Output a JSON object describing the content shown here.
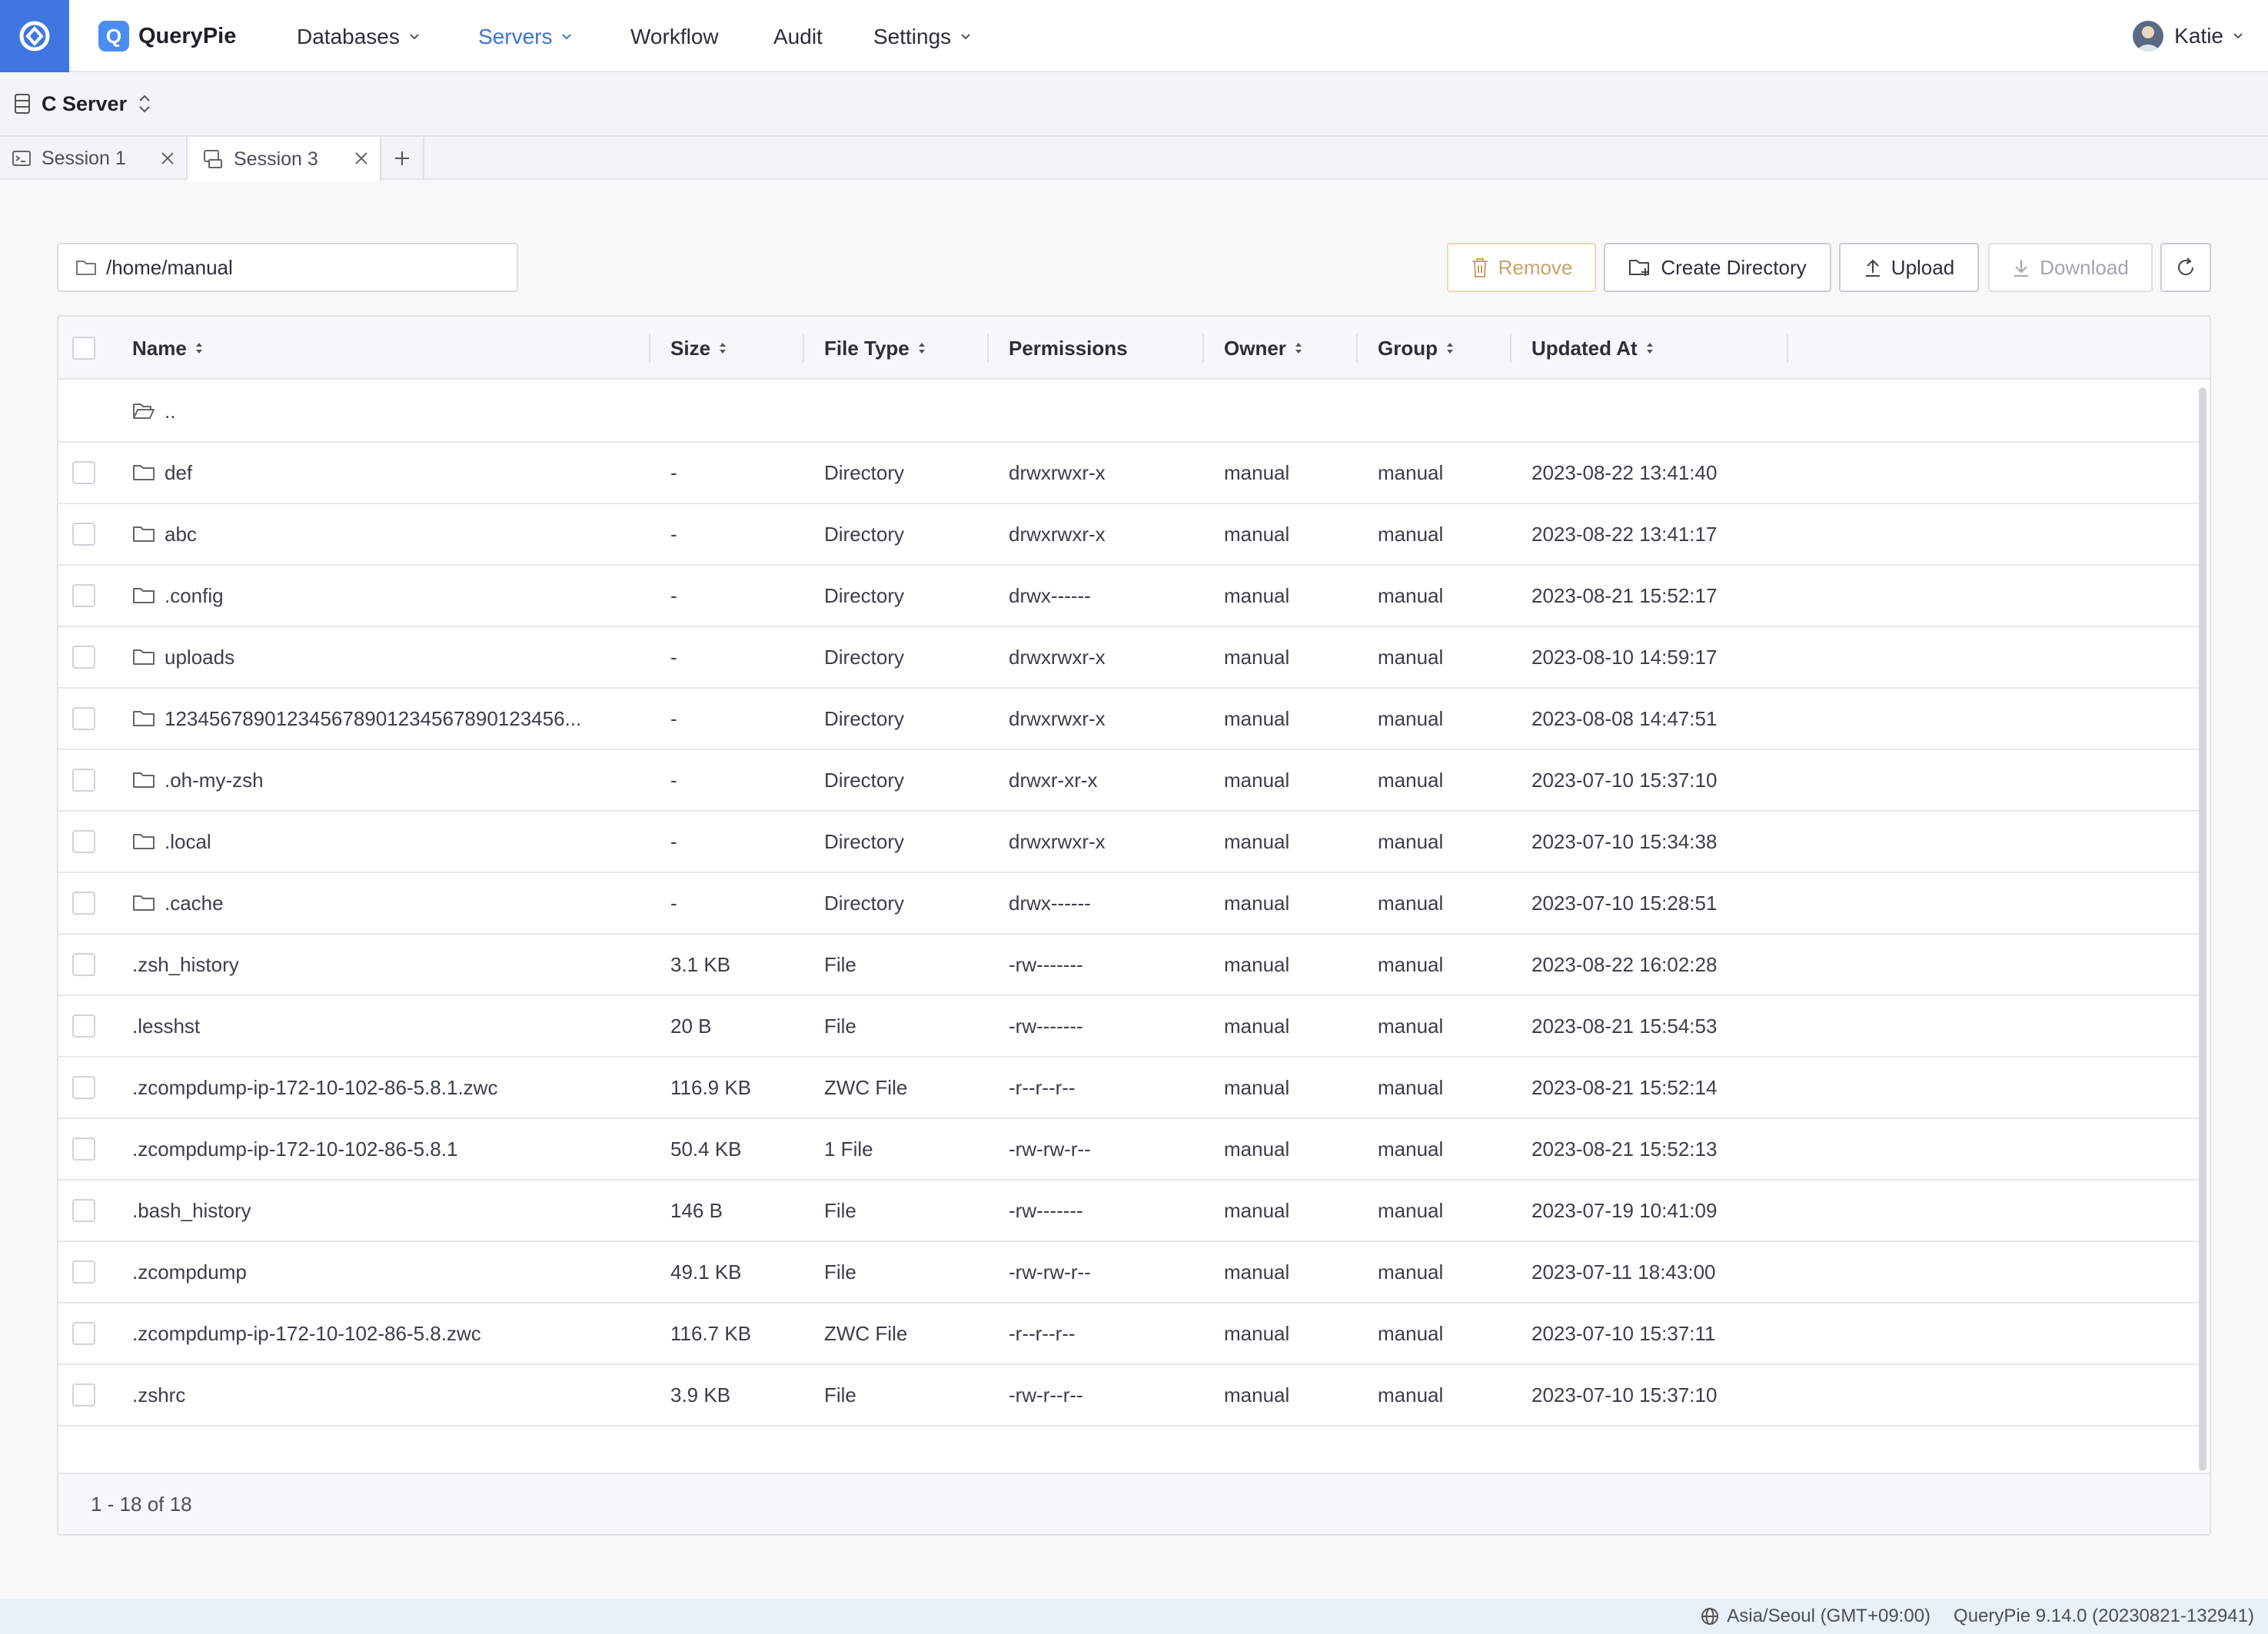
{
  "app": {
    "brand_name": "QueryPie",
    "brand_letter": "Q",
    "nav": [
      {
        "label": "Databases",
        "dropdown": true
      },
      {
        "label": "Servers",
        "dropdown": true,
        "active": true
      },
      {
        "label": "Workflow",
        "dropdown": false
      },
      {
        "label": "Audit",
        "dropdown": false
      },
      {
        "label": "Settings",
        "dropdown": true
      }
    ],
    "user_name": "Katie",
    "accent_color": "#3d72d9"
  },
  "server": {
    "name": "C Server"
  },
  "tabs": [
    {
      "label": "Session 1",
      "active": false
    },
    {
      "label": "Session 3",
      "active": true
    }
  ],
  "toolbar": {
    "path": "/home/manual",
    "remove_label": "Remove",
    "create_dir_label": "Create Directory",
    "upload_label": "Upload",
    "download_label": "Download"
  },
  "table": {
    "columns": [
      "Name",
      "Size",
      "File Type",
      "Permissions",
      "Owner",
      "Group",
      "Updated At"
    ],
    "parent_dir": "..",
    "rows": [
      {
        "name": "def",
        "folder": true,
        "size": "-",
        "type": "Directory",
        "perms": "drwxrwxr-x",
        "owner": "manual",
        "group": "manual",
        "updated": "2023-08-22 13:41:40"
      },
      {
        "name": "abc",
        "folder": true,
        "size": "-",
        "type": "Directory",
        "perms": "drwxrwxr-x",
        "owner": "manual",
        "group": "manual",
        "updated": "2023-08-22 13:41:17"
      },
      {
        "name": ".config",
        "folder": true,
        "size": "-",
        "type": "Directory",
        "perms": "drwx------",
        "owner": "manual",
        "group": "manual",
        "updated": "2023-08-21 15:52:17"
      },
      {
        "name": "uploads",
        "folder": true,
        "size": "-",
        "type": "Directory",
        "perms": "drwxrwxr-x",
        "owner": "manual",
        "group": "manual",
        "updated": "2023-08-10 14:59:17"
      },
      {
        "name": "123456789012345678901234567890123456...",
        "folder": true,
        "size": "-",
        "type": "Directory",
        "perms": "drwxrwxr-x",
        "owner": "manual",
        "group": "manual",
        "updated": "2023-08-08 14:47:51"
      },
      {
        "name": ".oh-my-zsh",
        "folder": true,
        "size": "-",
        "type": "Directory",
        "perms": "drwxr-xr-x",
        "owner": "manual",
        "group": "manual",
        "updated": "2023-07-10 15:37:10"
      },
      {
        "name": ".local",
        "folder": true,
        "size": "-",
        "type": "Directory",
        "perms": "drwxrwxr-x",
        "owner": "manual",
        "group": "manual",
        "updated": "2023-07-10 15:34:38"
      },
      {
        "name": ".cache",
        "folder": true,
        "size": "-",
        "type": "Directory",
        "perms": "drwx------",
        "owner": "manual",
        "group": "manual",
        "updated": "2023-07-10 15:28:51"
      },
      {
        "name": ".zsh_history",
        "folder": false,
        "size": "3.1 KB",
        "type": "File",
        "perms": "-rw-------",
        "owner": "manual",
        "group": "manual",
        "updated": "2023-08-22 16:02:28"
      },
      {
        "name": ".lesshst",
        "folder": false,
        "size": "20 B",
        "type": "File",
        "perms": "-rw-------",
        "owner": "manual",
        "group": "manual",
        "updated": "2023-08-21 15:54:53"
      },
      {
        "name": ".zcompdump-ip-172-10-102-86-5.8.1.zwc",
        "folder": false,
        "size": "116.9 KB",
        "type": "ZWC File",
        "perms": "-r--r--r--",
        "owner": "manual",
        "group": "manual",
        "updated": "2023-08-21 15:52:14"
      },
      {
        "name": ".zcompdump-ip-172-10-102-86-5.8.1",
        "folder": false,
        "size": "50.4 KB",
        "type": "1 File",
        "perms": "-rw-rw-r--",
        "owner": "manual",
        "group": "manual",
        "updated": "2023-08-21 15:52:13"
      },
      {
        "name": ".bash_history",
        "folder": false,
        "size": "146 B",
        "type": "File",
        "perms": "-rw-------",
        "owner": "manual",
        "group": "manual",
        "updated": "2023-07-19 10:41:09"
      },
      {
        "name": ".zcompdump",
        "folder": false,
        "size": "49.1 KB",
        "type": "File",
        "perms": "-rw-rw-r--",
        "owner": "manual",
        "group": "manual",
        "updated": "2023-07-11 18:43:00"
      },
      {
        "name": ".zcompdump-ip-172-10-102-86-5.8.zwc",
        "folder": false,
        "size": "116.7 KB",
        "type": "ZWC File",
        "perms": "-r--r--r--",
        "owner": "manual",
        "group": "manual",
        "updated": "2023-07-10 15:37:11"
      },
      {
        "name": ".zshrc",
        "folder": false,
        "size": "3.9 KB",
        "type": "File",
        "perms": "-rw-r--r--",
        "owner": "manual",
        "group": "manual",
        "updated": "2023-07-10 15:37:10"
      }
    ],
    "pagination": "1 - 18 of 18"
  },
  "status": {
    "timezone": "Asia/Seoul (GMT+09:00)",
    "version": "QueryPie 9.14.0 (20230821-132941)"
  }
}
